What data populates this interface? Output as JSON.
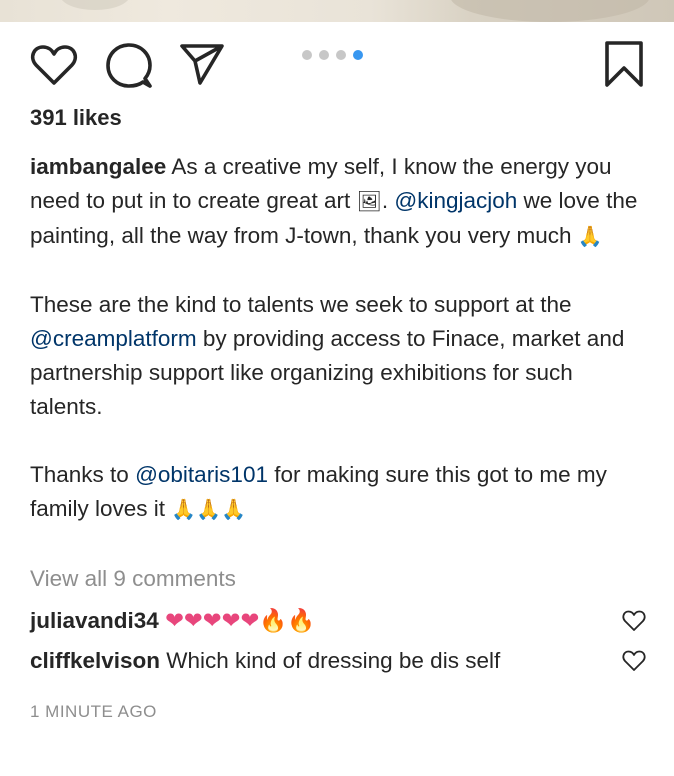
{
  "actions": {
    "like_icon": "heart-outline",
    "comment_icon": "speech-bubble",
    "share_icon": "paper-plane",
    "save_icon": "bookmark",
    "carousel": {
      "count": 4,
      "active_index": 3
    }
  },
  "likes": {
    "text": "391 likes"
  },
  "caption": {
    "username": "iambangalee",
    "p1_a": " As a creative my self, I know the energy you need to put in to create great art ",
    "p1_emoji1": "🖼",
    "p1_b": ". ",
    "mention1": "@kingjacjoh",
    "p1_c": " we love the painting, all the way from J-town, thank you very much ",
    "p1_emoji2": "🙏",
    "p2_a": "These are the kind to talents we seek to support at the ",
    "mention2": "@creamplatform",
    "p2_b": " by providing access to Finace, market and partnership support like organizing exhibitions for such talents.",
    "p3_a": "Thanks to ",
    "mention3": "@obitaris101",
    "p3_b": " for making sure this got to me my family loves it ",
    "p3_emoji": "🙏🙏🙏"
  },
  "view_all_comments": "View all 9 comments",
  "comments": [
    {
      "username": "juliavandi34",
      "hearts": "❤❤❤❤❤",
      "fires": "🔥🔥"
    },
    {
      "username": "cliffkelvison",
      "text": " Which kind of dressing be dis self"
    }
  ],
  "timestamp": "1 MINUTE AGO",
  "colors": {
    "accent": "#3897f0",
    "mention": "#003569",
    "muted": "#8e8e8e",
    "text": "#262626"
  }
}
